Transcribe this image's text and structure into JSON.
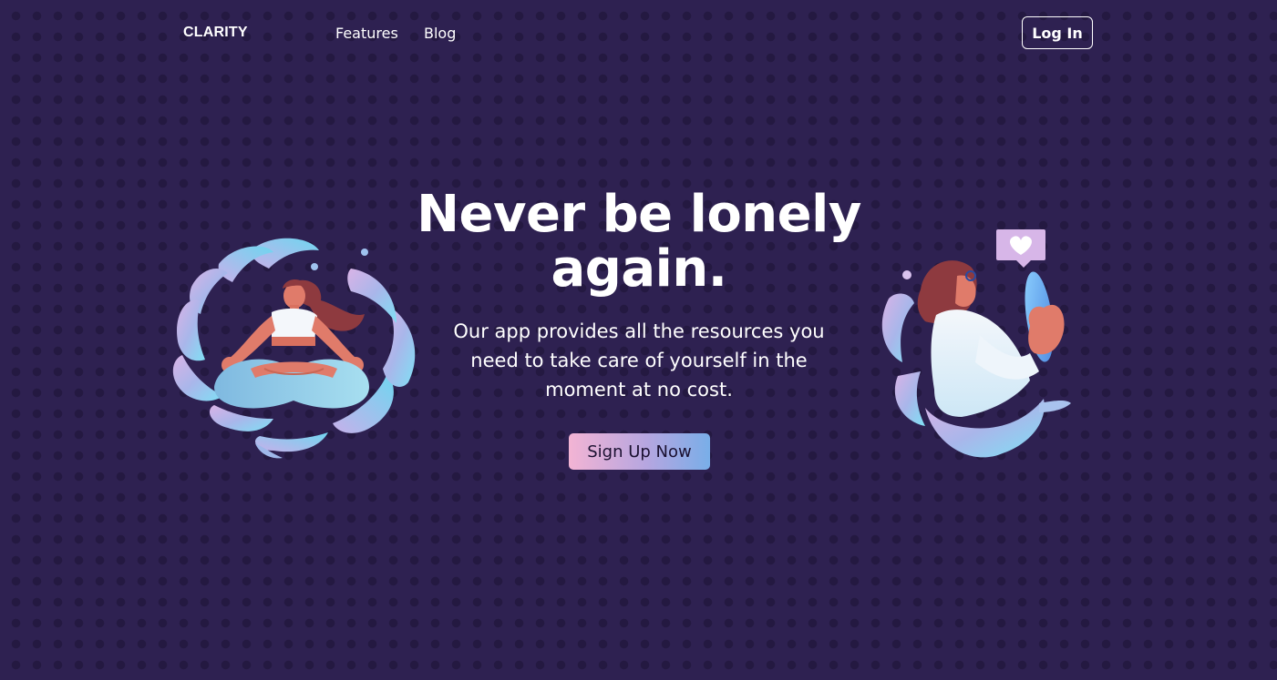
{
  "nav": {
    "logo": "CLARITY",
    "links": [
      "Features",
      "Blog"
    ],
    "login_label": "Log In"
  },
  "hero": {
    "title": "Never be lonely again.",
    "subtitle": "Our app provides all the resources you need to take care of yourself in the moment at no cost.",
    "cta_label": "Sign Up Now"
  },
  "illustrations": {
    "left": "meditating-woman-illustration",
    "right": "woman-with-phone-illustration"
  },
  "colors": {
    "background": "#2e2151",
    "dot": "#241941",
    "cta_gradient_start": "#f3b4d4",
    "cta_gradient_end": "#79aee8"
  }
}
